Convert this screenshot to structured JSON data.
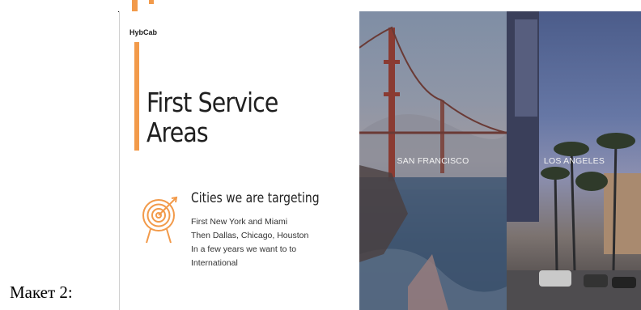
{
  "captions": {
    "bottom": "Макет 2:"
  },
  "slide": {
    "brand": "HybCab",
    "title_line1": "First Service",
    "title_line2": "Areas",
    "subheading": "Cities we are targeting",
    "description": [
      "First New York and Miami",
      "Then Dallas, Chicago, Houston",
      "In a few years we want to to",
      "International"
    ],
    "icons": {
      "target": "target-arrow-icon"
    },
    "colors": {
      "accent": "#f29a4a"
    }
  },
  "cities": [
    {
      "label": "SAN FRANCISCO"
    },
    {
      "label": "LOS ANGELES"
    }
  ]
}
